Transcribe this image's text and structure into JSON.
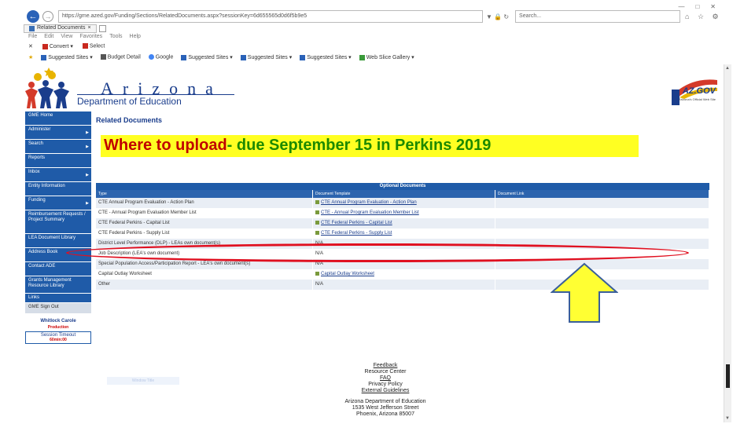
{
  "browser": {
    "url": "https://gme.azed.gov/Funding/Sections/RelatedDocuments.aspx?sessionKey=6d655565d0d6f5b9e5",
    "search_placeholder": "Search...",
    "tab_title": "Related Documents",
    "menu": [
      "File",
      "Edit",
      "View",
      "Favorites",
      "Tools",
      "Help"
    ],
    "command_items": [
      "Convert",
      "Select"
    ],
    "favorites": [
      "Suggested Sites",
      "Budget Detail",
      "Google",
      "Suggested Sites",
      "Suggested Sites",
      "Suggested Sites",
      "Web Slice Gallery"
    ]
  },
  "header": {
    "brand_name": "Arizona",
    "brand_sub": "Department of Education",
    "azgov_text": "AZ.GOV",
    "azgov_sub": "Arizona's Official Web Site"
  },
  "sidebar": {
    "items": [
      {
        "label": "GME Home",
        "arrow": false
      },
      {
        "label": "Administer",
        "arrow": true
      },
      {
        "label": "Search",
        "arrow": true
      },
      {
        "label": "Reports",
        "arrow": false
      },
      {
        "label": "Inbox",
        "arrow": true
      },
      {
        "label": "Entity Information",
        "arrow": false
      },
      {
        "label": "Funding",
        "arrow": true
      },
      {
        "label": "Reimbursement Requests / Project Summary",
        "arrow": false
      },
      {
        "label": "LEA Document Library",
        "arrow": false
      },
      {
        "label": "Address Book",
        "arrow": false
      },
      {
        "label": "Contact ADE",
        "arrow": false
      },
      {
        "label": "Grants Management Resource Library",
        "arrow": false
      },
      {
        "label": "Links",
        "arrow": false
      },
      {
        "label": "GME Sign Out",
        "arrow": false
      }
    ],
    "user_name": "Whitlock Carole",
    "environment": "Production",
    "session_label": "Session Timeout",
    "session_time": "60min:00"
  },
  "main": {
    "section_title": "Related Documents",
    "banner_lead": "Where to upload",
    "banner_rest": "- due September 15 in Perkins 2019",
    "table": {
      "caption": "Optional Documents",
      "columns": [
        "Type",
        "Document Template",
        "Document Link"
      ],
      "rows": [
        {
          "type": "CTE Annual Program Evaluation - Action Plan",
          "template": "CTE Annual Program Evaluation - Action Plan",
          "link": ""
        },
        {
          "type": "CTE - Annual Program Evaluation Member List",
          "template": "CTE - Annual Program Evaluation Member List",
          "link": ""
        },
        {
          "type": "CTE Federal Perkins - Capital List",
          "template": "CTE Federal Perkins - Capital List",
          "link": ""
        },
        {
          "type": "CTE Federal Perkins - Supply List",
          "template": "CTE Federal Perkins - Supply List",
          "link": ""
        },
        {
          "type": "District Level Performance (DLP) - LEAs own document(s)",
          "template": "N/A",
          "link": ""
        },
        {
          "type": "Job Description (LEA's own document)",
          "template": "N/A",
          "link": ""
        },
        {
          "type": "Special Population Access/Participation Report - LEA's own document(s)",
          "template": "N/A",
          "link": ""
        },
        {
          "type": "Capital Outlay Worksheet",
          "template": "Capital Outlay Worksheet",
          "link": ""
        },
        {
          "type": "Other",
          "template": "N/A",
          "link": ""
        }
      ]
    }
  },
  "footer": {
    "links": [
      "Feedback",
      "Resource Center",
      "FAQ",
      "Privacy Policy",
      "External Guidelines"
    ],
    "address": [
      "Arizona Department of Education",
      "1535 West Jefferson Street",
      "Phoenix, Arizona 85007"
    ],
    "faint_label": "Window Title"
  },
  "colors": {
    "nav_blue": "#1f5ba8",
    "banner_yellow": "#ffff22",
    "banner_red": "#c00000",
    "banner_green": "#1d8a00",
    "ellipse_red": "#e01020",
    "arrow_yellow": "#ffff33"
  }
}
